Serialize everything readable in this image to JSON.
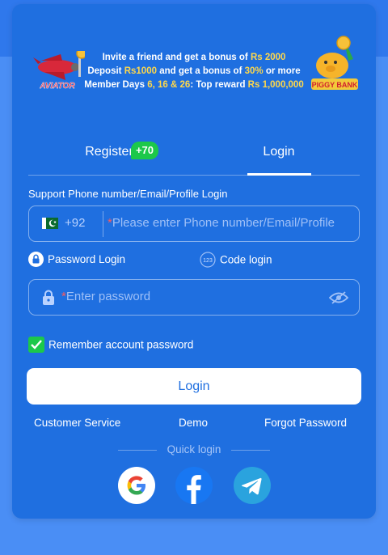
{
  "banner": {
    "line1_prefix": "Invite a friend and get a bonus of ",
    "line1_amount": "Rs 2000",
    "line2_prefix": "Deposit ",
    "line2_amount": "Rs1000",
    "line2_mid": " and get a bonus of ",
    "line2_pct": "30%",
    "line2_suffix": " or more",
    "line3_prefix": "Member Days ",
    "line3_days": "6, 16 & 26",
    "line3_mid": ": Top reward ",
    "line3_amount": "Rs 1,000,000",
    "aviator_text": "AVIATOR",
    "piggy_text": "PIGGY BANK"
  },
  "tabs": {
    "register_label": "Register",
    "register_badge": "+70",
    "login_label": "Login",
    "active": "login"
  },
  "phone_field": {
    "label": "Support Phone number/Email/Profile Login",
    "country_code": "+92",
    "required_mark": "*",
    "placeholder": "Please enter Phone number/Email/Profile"
  },
  "login_modes": {
    "password_label": "Password Login",
    "code_label": "Code login",
    "code_icon_text": "123"
  },
  "password_field": {
    "required_mark": "*",
    "placeholder": "Enter password"
  },
  "remember": {
    "label": "Remember account password",
    "checked": true
  },
  "login_button": {
    "label": "Login"
  },
  "links": {
    "customer_service": "Customer Service",
    "demo": "Demo",
    "forgot_password": "Forgot Password"
  },
  "quick_login": {
    "label": "Quick login",
    "providers": [
      "google-icon",
      "facebook-icon",
      "telegram-icon"
    ]
  },
  "colors": {
    "card": "#1f6fe0",
    "page": "#4a8ef5",
    "highlight": "#ffd84a",
    "badge": "#1cc84a"
  }
}
